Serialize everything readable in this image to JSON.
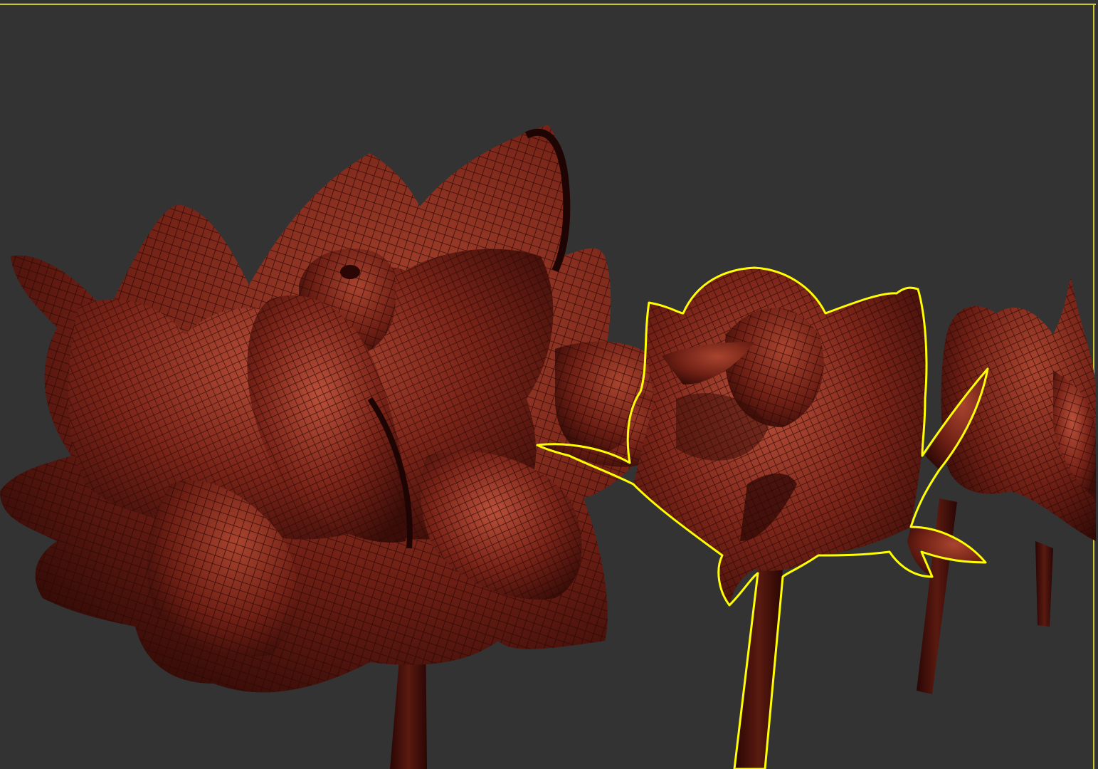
{
  "viewport": {
    "background_color": "#333333",
    "active_border_color": "#c8c832",
    "selection_outline_color": "#ffff00",
    "mesh_base_color": "#7a2418",
    "mesh_highlight_color": "#b8503a",
    "mesh_shadow_color": "#3a0d08",
    "wireframe_color": "#2a0604"
  },
  "scene": {
    "objects": [
      {
        "name": "rose-large-left",
        "selected": false
      },
      {
        "name": "rose-bud-center",
        "selected": true
      },
      {
        "name": "rose-bud-right",
        "selected": false
      }
    ]
  }
}
